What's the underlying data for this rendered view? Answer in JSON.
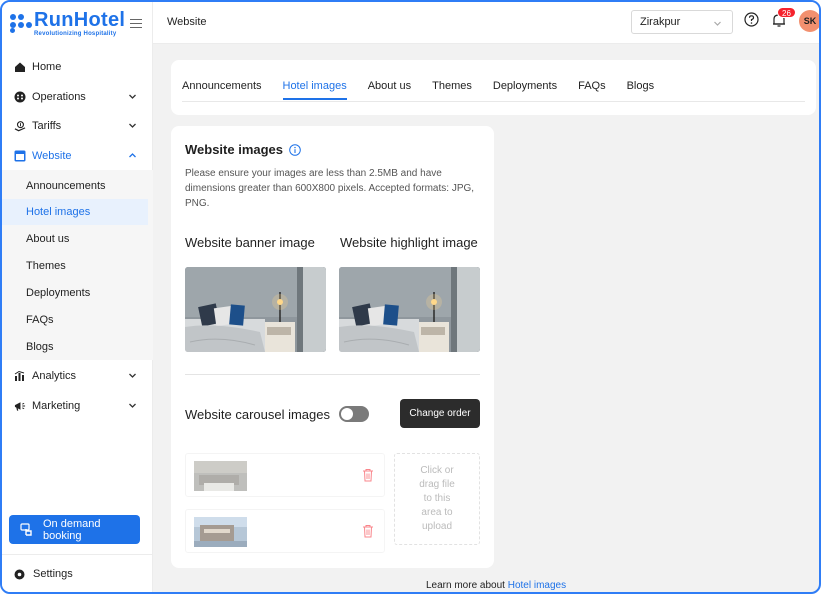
{
  "brand": {
    "name": "RunHotel",
    "tagline": "Revolutionizing Hospitality",
    "color": "#1e72e8"
  },
  "sidebar": {
    "items": [
      {
        "label": "Home",
        "icon": "home-icon"
      },
      {
        "label": "Operations",
        "icon": "operations-icon"
      },
      {
        "label": "Tariffs",
        "icon": "tariffs-icon"
      },
      {
        "label": "Website",
        "icon": "website-icon"
      }
    ],
    "website_sub": [
      {
        "label": "Announcements"
      },
      {
        "label": "Hotel images"
      },
      {
        "label": "About us"
      },
      {
        "label": "Themes"
      },
      {
        "label": "Deployments"
      },
      {
        "label": "FAQs"
      },
      {
        "label": "Blogs"
      }
    ],
    "lower_items": [
      {
        "label": "Analytics",
        "icon": "analytics-icon"
      },
      {
        "label": "Marketing",
        "icon": "marketing-icon"
      }
    ],
    "demand_button": "On demand booking",
    "settings": "Settings"
  },
  "topbar": {
    "title": "Website",
    "location": "Zirakpur",
    "notification_count": "26",
    "avatar_initials": "SK"
  },
  "tabs": [
    "Announcements",
    "Hotel images",
    "About us",
    "Themes",
    "Deployments",
    "FAQs",
    "Blogs"
  ],
  "active_tab": "Hotel images",
  "website_images": {
    "title": "Website images",
    "description": "Please ensure your images are less than 2.5MB and have dimensions greater than 600X800 pixels. Accepted formats: JPG, PNG.",
    "banner_label": "Website banner image",
    "highlight_label": "Website highlight image",
    "carousel_label": "Website carousel images",
    "carousel_toggle_on": false,
    "change_order": "Change order",
    "upload_text": [
      "Click or",
      "drag file",
      "to this",
      "area to",
      "upload"
    ]
  },
  "footer": {
    "prefix": "Learn more about ",
    "link": "Hotel images"
  }
}
